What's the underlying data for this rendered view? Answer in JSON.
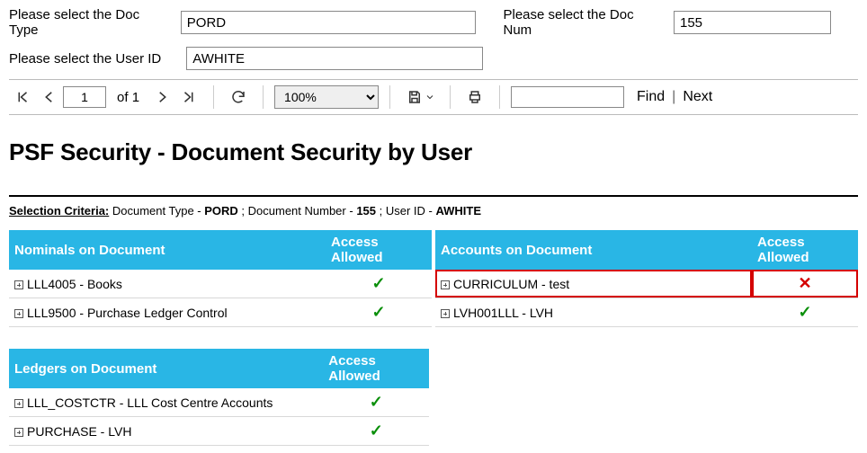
{
  "params": {
    "docTypeLabel": "Please select the Doc Type",
    "docTypeValue": "PORD",
    "docNumLabel": "Please select the Doc Num",
    "docNumValue": "155",
    "userIdLabel": "Please select the User ID",
    "userIdValue": "AWHITE"
  },
  "toolbar": {
    "pageCurrent": "1",
    "pageOf": "of",
    "pageTotal": "1",
    "zoom": "100%",
    "findLabel": "Find",
    "nextLabel": "Next"
  },
  "report": {
    "title": "PSF Security - Document Security by User",
    "criteriaLabel": "Selection Criteria:",
    "criteriaPrefix1": "  Document Type - ",
    "criteriaVal1": "PORD",
    "criteriaPrefix2": " ; Document Number - ",
    "criteriaVal2": "155",
    "criteriaPrefix3": " ; User ID - ",
    "criteriaVal3": "AWHITE"
  },
  "tables": {
    "nominals": {
      "hdr1": "Nominals on Document",
      "hdr2": "Access Allowed",
      "rows": [
        {
          "label": "LLL4005 - Books",
          "allowed": true
        },
        {
          "label": "LLL9500 - Purchase Ledger Control",
          "allowed": true
        }
      ]
    },
    "accounts": {
      "hdr1": "Accounts on Document",
      "hdr2": "Access Allowed",
      "rows": [
        {
          "label": "CURRICULUM - test",
          "allowed": false,
          "highlight": true
        },
        {
          "label": "LVH001LLL - LVH",
          "allowed": true
        }
      ]
    },
    "ledgers": {
      "hdr1": "Ledgers on Document",
      "hdr2": "Access Allowed",
      "rows": [
        {
          "label": "LLL_COSTCTR - LLL Cost Centre Accounts",
          "allowed": true
        },
        {
          "label": "PURCHASE - LVH",
          "allowed": true
        }
      ]
    }
  }
}
